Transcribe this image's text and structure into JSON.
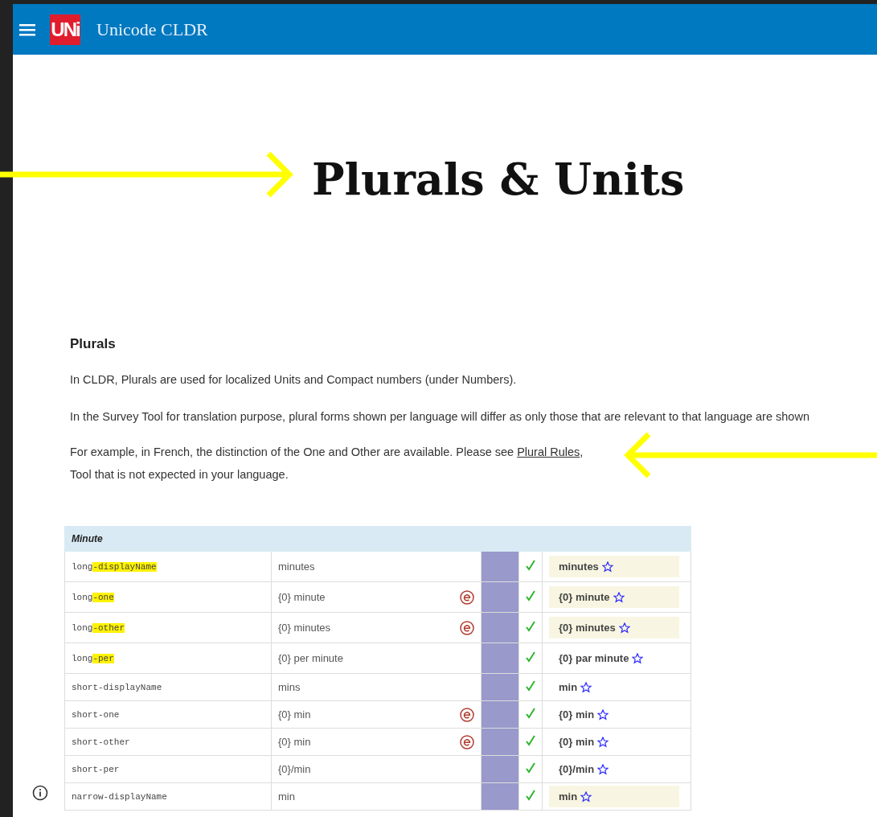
{
  "header": {
    "logo": "UNi",
    "title": "Unicode CLDR"
  },
  "page_title": "Plurals & Units",
  "section": {
    "heading": "Plurals",
    "paragraphs": [
      "In CLDR, Plurals are used for localized Units and Compact numbers (under Numbers).",
      "In the Survey Tool for translation purpose, plural forms shown per language will differ as only those that are relevant to that language are shown"
    ],
    "example": {
      "before": "For example, in French, the distinction of the One and Other are available. Please see ",
      "link": "Plural Rules",
      "after": ",",
      "continuation": "Tool that is not expected in your language."
    }
  },
  "table": {
    "title": "Minute",
    "rows": [
      {
        "code_prefix": "long",
        "code_suffix": "-displayName",
        "highlighted": true,
        "english": "minutes",
        "error": false,
        "winning": "minutes",
        "shaded": true
      },
      {
        "code_prefix": "long",
        "code_suffix": "-one",
        "highlighted": true,
        "english": "{0} minute",
        "error": true,
        "winning": "{0} minute",
        "shaded": true
      },
      {
        "code_prefix": "long",
        "code_suffix": "-other",
        "highlighted": true,
        "english": "{0} minutes",
        "error": true,
        "winning": "{0} minutes",
        "shaded": true
      },
      {
        "code_prefix": "long",
        "code_suffix": "-per",
        "highlighted": true,
        "english": "{0} per minute",
        "error": false,
        "winning": "{0} par minute",
        "shaded": false
      },
      {
        "code_prefix": "short",
        "code_suffix": "-displayName",
        "highlighted": false,
        "english": "mins",
        "error": false,
        "winning": "min",
        "shaded": false
      },
      {
        "code_prefix": "short",
        "code_suffix": "-one",
        "highlighted": false,
        "english": "{0} min",
        "error": true,
        "winning": "{0} min",
        "shaded": false
      },
      {
        "code_prefix": "short",
        "code_suffix": "-other",
        "highlighted": false,
        "english": "{0} min",
        "error": true,
        "winning": "{0} min",
        "shaded": false
      },
      {
        "code_prefix": "short",
        "code_suffix": "-per",
        "highlighted": false,
        "english": "{0}/min",
        "error": false,
        "winning": "{0}/min",
        "shaded": false
      },
      {
        "code_prefix": "narrow",
        "code_suffix": "-displayName",
        "highlighted": false,
        "english": "min",
        "error": false,
        "winning": "min",
        "shaded": true
      }
    ]
  }
}
